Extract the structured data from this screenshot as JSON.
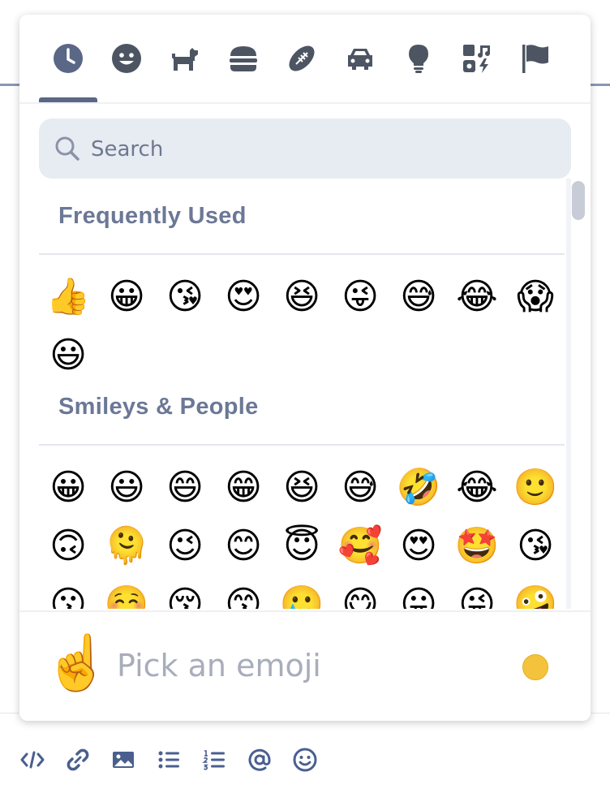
{
  "categories": [
    {
      "name": "recent",
      "icon": "clock-icon",
      "active": true
    },
    {
      "name": "smileys",
      "icon": "smiley-icon"
    },
    {
      "name": "animals",
      "icon": "dog-icon"
    },
    {
      "name": "food",
      "icon": "burger-icon"
    },
    {
      "name": "activity",
      "icon": "football-icon"
    },
    {
      "name": "travel",
      "icon": "car-icon"
    },
    {
      "name": "objects",
      "icon": "lightbulb-icon"
    },
    {
      "name": "symbols",
      "icon": "symbols-icon"
    },
    {
      "name": "flags",
      "icon": "flag-icon"
    }
  ],
  "search": {
    "placeholder": "Search"
  },
  "sections": {
    "frequent": {
      "title": "Frequently Used",
      "emojis": [
        "👍",
        "😀",
        "😘",
        "😍",
        "😆",
        "😜",
        "😅",
        "😂",
        "😱",
        "😃"
      ]
    },
    "smileys": {
      "title": "Smileys & People",
      "emojis": [
        "😀",
        "😃",
        "😄",
        "😁",
        "😆",
        "😅",
        "🤣",
        "😂",
        "🙂",
        "🙃",
        "🫠",
        "😉",
        "😊",
        "😇",
        "🥰",
        "😍",
        "🤩",
        "😘",
        "😗",
        "☺️",
        "😚",
        "😙",
        "🥲",
        "😋",
        "😛",
        "😜",
        "🤪"
      ]
    }
  },
  "footer": {
    "preview_emoji": "☝️",
    "text": "Pick an emoji",
    "skin_tone_color": "#f5c33b"
  },
  "toolbar": [
    "code-icon",
    "link-icon",
    "image-icon",
    "bullet-list-icon",
    "numbered-list-icon",
    "mention-icon",
    "emoji-icon"
  ],
  "colors": {
    "accent": "#5a6786",
    "icon": "#4d5563",
    "heading": "#6b7896",
    "search_bg": "#e7ebf2",
    "toolbar_icon": "#4a5f8f"
  }
}
